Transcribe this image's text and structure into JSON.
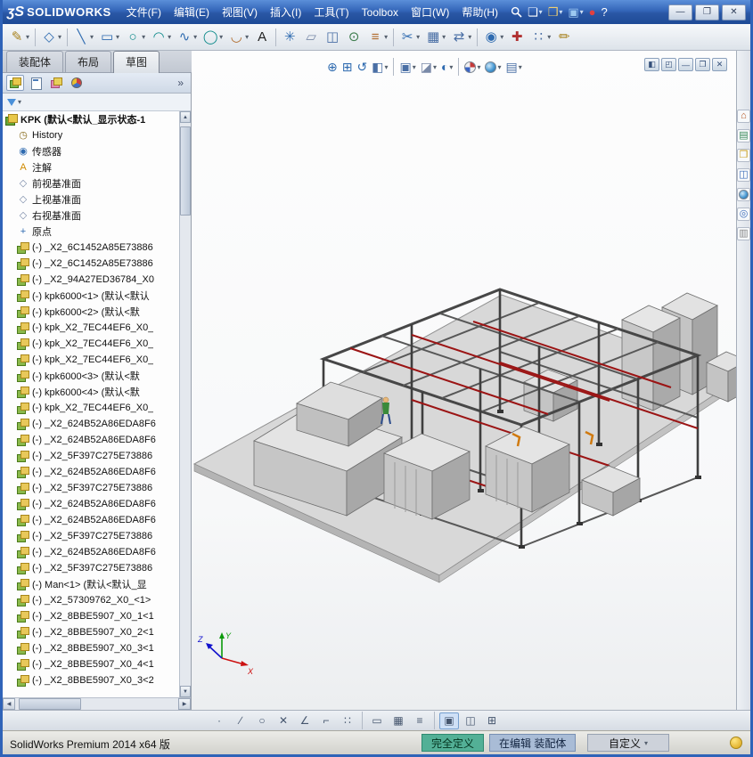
{
  "titlebar": {
    "brand_mark": "ʒS",
    "brand_name": "SOLIDWORKS",
    "men_note": "",
    "menus": [
      {
        "name": "menu-file",
        "label": "文件(F)"
      },
      {
        "name": "menu-edit",
        "label": "编辑(E)"
      },
      {
        "name": "menu-view",
        "label": "视图(V)"
      },
      {
        "name": "menu-insert",
        "label": "插入(I)"
      },
      {
        "name": "menu-tools",
        "label": "工具(T)"
      },
      {
        "name": "menu-toolbox",
        "label": "Toolbox"
      },
      {
        "name": "menu-window",
        "label": "窗口(W)"
      },
      {
        "name": "menu-help",
        "label": "帮助(H)"
      }
    ],
    "quick_icons": [
      {
        "name": "new-document-icon",
        "glyph": "❏",
        "color": "#ffffff",
        "dd": true
      },
      {
        "name": "open-icon",
        "glyph": "❒",
        "color": "#f0d070",
        "dd": true
      },
      {
        "name": "save-icon",
        "glyph": "▣",
        "color": "#9cc8f0",
        "dd": true
      },
      {
        "name": "rebuild-icon",
        "glyph": "●",
        "color": "#e04040"
      },
      {
        "name": "help-icon",
        "glyph": "?",
        "color": "#ffffff"
      }
    ],
    "window_controls": [
      {
        "name": "minimize-button",
        "glyph": "—"
      },
      {
        "name": "restore-button",
        "glyph": "❐"
      },
      {
        "name": "close-button",
        "glyph": "✕"
      }
    ]
  },
  "ribbon": {
    "icons": [
      {
        "name": "sketch-icon",
        "glyph": "✎",
        "color": "#a8821e",
        "dd": true
      },
      {
        "sep": true
      },
      {
        "name": "smart-dimension-icon",
        "glyph": "◇",
        "color": "#2f6bb0",
        "dd": true
      },
      {
        "sep": true
      },
      {
        "name": "line-icon",
        "glyph": "╲",
        "color": "#2f6bb0",
        "dd": true
      },
      {
        "name": "rectangle-icon",
        "glyph": "▭",
        "color": "#2f6bb0",
        "dd": true
      },
      {
        "name": "circle-icon",
        "glyph": "○",
        "color": "#0f8b8b",
        "dd": true
      },
      {
        "name": "arc-icon",
        "glyph": "◠",
        "color": "#0f8b8b",
        "dd": true
      },
      {
        "name": "spline-icon",
        "glyph": "∿",
        "color": "#2f6bb0",
        "dd": true
      },
      {
        "name": "ellipse-icon",
        "glyph": "◯",
        "color": "#0f8b8b",
        "dd": true
      },
      {
        "name": "fillet-icon",
        "glyph": "◡",
        "color": "#b06a2a",
        "dd": true
      },
      {
        "name": "text-icon",
        "glyph": "A",
        "color": "#222222"
      },
      {
        "sep": true
      },
      {
        "name": "point-icon",
        "glyph": "✳",
        "color": "#2f6bb0"
      },
      {
        "name": "plane-icon",
        "glyph": "▱",
        "color": "#7a8aa8"
      },
      {
        "name": "mirror-entities-icon",
        "glyph": "◫",
        "color": "#4a6fa5"
      },
      {
        "name": "convert-entities-icon",
        "glyph": "⊙",
        "color": "#3a7a4a"
      },
      {
        "name": "offset-entities-icon",
        "glyph": "≡",
        "color": "#b06a2a",
        "dd": true
      },
      {
        "sep": true
      },
      {
        "name": "trim-entities-icon",
        "glyph": "✂",
        "color": "#2f6bb0",
        "dd": true
      },
      {
        "name": "linear-pattern-icon",
        "glyph": "▦",
        "color": "#4a6fa5",
        "dd": true
      },
      {
        "name": "move-entities-icon",
        "glyph": "⇄",
        "color": "#4a6fa5",
        "dd": true
      },
      {
        "sep": true
      },
      {
        "name": "display-relations-icon",
        "glyph": "◉",
        "color": "#2f6bb0",
        "dd": true
      },
      {
        "name": "repair-sketch-icon",
        "glyph": "✚",
        "color": "#b03030"
      },
      {
        "name": "quick-snaps-icon",
        "glyph": "∷",
        "color": "#4a6fa5",
        "dd": true
      },
      {
        "name": "rapid-sketch-icon",
        "glyph": "✏",
        "color": "#a8821e"
      }
    ]
  },
  "command_tabs": [
    {
      "name": "tab-assembly",
      "label": "装配体"
    },
    {
      "name": "tab-layout",
      "label": "布局"
    },
    {
      "name": "tab-sketch",
      "label": "草图",
      "active": true
    }
  ],
  "feature_panel": {
    "expand_glyph": "»",
    "tree": {
      "root_label": "KPK  (默认<默认_显示状态-1",
      "items": [
        {
          "name": "tree-item-history",
          "glyph": "◷",
          "color": "#8a6d1e",
          "label": "History"
        },
        {
          "name": "tree-item-sensors",
          "glyph": "◉",
          "color": "#2f6bb0",
          "label": "传感器"
        },
        {
          "name": "tree-item-annotations",
          "glyph": "A",
          "color": "#d08a00",
          "label": "注解"
        },
        {
          "name": "tree-item-front-plane",
          "glyph": "◇",
          "color": "#7a8aa8",
          "label": "前视基准面"
        },
        {
          "name": "tree-item-top-plane",
          "glyph": "◇",
          "color": "#7a8aa8",
          "label": "上视基准面"
        },
        {
          "name": "tree-item-right-plane",
          "glyph": "◇",
          "color": "#7a8aa8",
          "label": "右视基准面"
        },
        {
          "name": "tree-item-origin",
          "glyph": "+",
          "color": "#2f6bb0",
          "label": "原点"
        },
        {
          "icon": "component",
          "label": "(-) _X2_6C1452A85E73886"
        },
        {
          "icon": "component",
          "label": "(-) _X2_6C1452A85E73886"
        },
        {
          "icon": "component",
          "label": "(-) _X2_94A27ED36784_X0"
        },
        {
          "icon": "component",
          "label": "(-) kpk6000<1> (默认<默认"
        },
        {
          "icon": "component",
          "label": "(-) kpk6000<2> (默认<默"
        },
        {
          "icon": "component",
          "label": "(-) kpk_X2_7EC44EF6_X0_"
        },
        {
          "icon": "component",
          "label": "(-) kpk_X2_7EC44EF6_X0_"
        },
        {
          "icon": "component",
          "label": "(-) kpk_X2_7EC44EF6_X0_"
        },
        {
          "icon": "component",
          "label": "(-) kpk6000<3> (默认<默"
        },
        {
          "icon": "component",
          "label": "(-) kpk6000<4> (默认<默"
        },
        {
          "icon": "component",
          "label": "(-) kpk_X2_7EC44EF6_X0_"
        },
        {
          "icon": "component",
          "label": "(-) _X2_624B52A86EDA8F6"
        },
        {
          "icon": "component",
          "label": "(-) _X2_624B52A86EDA8F6"
        },
        {
          "icon": "component",
          "label": "(-) _X2_5F397C275E73886"
        },
        {
          "icon": "component",
          "label": "(-) _X2_624B52A86EDA8F6"
        },
        {
          "icon": "component",
          "label": "(-) _X2_5F397C275E73886"
        },
        {
          "icon": "component",
          "label": "(-) _X2_624B52A86EDA8F6"
        },
        {
          "icon": "component",
          "label": "(-) _X2_624B52A86EDA8F6"
        },
        {
          "icon": "component",
          "label": "(-) _X2_5F397C275E73886"
        },
        {
          "icon": "component",
          "label": "(-) _X2_624B52A86EDA8F6"
        },
        {
          "icon": "component",
          "label": "(-) _X2_5F397C275E73886"
        },
        {
          "name": "tree-item-man",
          "icon": "component",
          "label": "(-) Man<1> (默认<默认_显"
        },
        {
          "icon": "component",
          "label": "(-) _X2_57309762_X0_<1>"
        },
        {
          "icon": "component",
          "label": "(-) _X2_8BBE5907_X0_1<1"
        },
        {
          "icon": "component",
          "label": "(-) _X2_8BBE5907_X0_2<1"
        },
        {
          "icon": "component",
          "label": "(-) _X2_8BBE5907_X0_3<1"
        },
        {
          "icon": "component",
          "label": "(-) _X2_8BBE5907_X0_4<1"
        },
        {
          "icon": "component",
          "label": "(-) _X2_8BBE5907_X0_3<2"
        }
      ]
    }
  },
  "viewport": {
    "heads_up_icons": [
      {
        "name": "zoom-fit-icon",
        "glyph": "⊕",
        "color": "#2f6bb0"
      },
      {
        "name": "zoom-area-icon",
        "glyph": "⊞",
        "color": "#2f6bb0"
      },
      {
        "name": "previous-view-icon",
        "glyph": "↺",
        "color": "#2f6bb0"
      },
      {
        "name": "section-view-icon",
        "glyph": "◧",
        "color": "#4a6fa5",
        "dd": true
      },
      {
        "sep": true
      },
      {
        "name": "view-orientation-icon",
        "glyph": "▣",
        "color": "#4a6fa5",
        "dd": true
      },
      {
        "name": "display-style-icon",
        "glyph": "◪",
        "color": "#7a8aa8",
        "dd": true
      },
      {
        "name": "hide-show-items-icon",
        "glyph": "◐",
        "color": "#2f6bb0",
        "dd": true
      },
      {
        "sep": true
      },
      {
        "name": "edit-appearance-icon",
        "cls": "ball-appearance",
        "dd": true
      },
      {
        "name": "apply-scene-icon",
        "cls": "ball-scene",
        "dd": true
      },
      {
        "name": "view-settings-icon",
        "glyph": "▤",
        "color": "#4a6fa5",
        "dd": true
      }
    ],
    "doc_controls": [
      {
        "name": "pane-split-left-icon",
        "glyph": "◧"
      },
      {
        "name": "pane-split-top-icon",
        "glyph": "◰"
      },
      {
        "name": "doc-minimize-button",
        "glyph": "—"
      },
      {
        "name": "doc-restore-button",
        "glyph": "❐"
      },
      {
        "name": "doc-close-button",
        "glyph": "✕"
      }
    ],
    "triad": {
      "x": "X",
      "y": "Y",
      "z": "Z"
    }
  },
  "task_pane": {
    "icons": [
      {
        "name": "resources-icon",
        "glyph": "⌂",
        "color": "#b5541e"
      },
      {
        "name": "design-library-icon",
        "glyph": "▤",
        "color": "#3a8a5a"
      },
      {
        "name": "file-explorer-icon",
        "glyph": "❒",
        "color": "#c8a020"
      },
      {
        "name": "view-palette-icon",
        "glyph": "◫",
        "color": "#3a6ab8"
      },
      {
        "name": "appearances-icon",
        "cls": "ball-scene"
      },
      {
        "name": "custom-properties-icon",
        "glyph": "◎",
        "color": "#3a6ab8"
      },
      {
        "name": "document-recovery-icon",
        "glyph": "▥",
        "color": "#888888"
      }
    ]
  },
  "bottom_toolbar": {
    "icons": [
      {
        "name": "snap-point-icon",
        "glyph": "·"
      },
      {
        "name": "snap-line-icon",
        "glyph": "∕"
      },
      {
        "name": "snap-circle-icon",
        "glyph": "○"
      },
      {
        "name": "snap-intersection-icon",
        "glyph": "✕"
      },
      {
        "name": "snap-angle-icon",
        "glyph": "∠"
      },
      {
        "name": "snap-parallel-icon",
        "glyph": "⌐"
      },
      {
        "name": "snap-grid-icon",
        "glyph": "∷"
      },
      {
        "sep": true
      },
      {
        "name": "sketch-grid-icon",
        "glyph": "▭"
      },
      {
        "name": "grid-display-icon",
        "glyph": "▦"
      },
      {
        "name": "snap-settings-icon",
        "glyph": "≡"
      },
      {
        "sep": true
      },
      {
        "name": "view-single-icon",
        "glyph": "▣",
        "active": true
      },
      {
        "name": "view-two-icon",
        "glyph": "◫"
      },
      {
        "name": "view-four-icon",
        "glyph": "⊞"
      }
    ]
  },
  "statusbar": {
    "message": "SolidWorks Premium 2014 x64 版",
    "defined": "完全定义",
    "editing": "在编辑 装配体",
    "custom": "自定义",
    "custom_dd": "▾"
  },
  "ui": {
    "scroll_up": "▲",
    "scroll_down": "▼",
    "scroll_left": "◀",
    "scroll_right": "▶",
    "filter_dd": "▾"
  }
}
